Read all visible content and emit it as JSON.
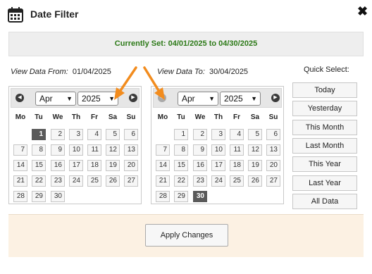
{
  "dialog": {
    "title": "Date Filter",
    "close_label": "✖"
  },
  "current_set": "Currently Set: 04/01/2025 to 04/30/2025",
  "range": {
    "from_label": "View Data From:",
    "from_value": "01/04/2025",
    "to_label": "View Data To:",
    "to_value": "30/04/2025"
  },
  "weekdays": [
    "Mo",
    "Tu",
    "We",
    "Th",
    "Fr",
    "Sa",
    "Su"
  ],
  "from_calendar": {
    "month": "Apr",
    "year": "2025",
    "prev_label": "◀",
    "next_label": "▶",
    "start_weekday_index": 1,
    "days_in_month": 30,
    "selected_day": 1
  },
  "to_calendar": {
    "month": "Apr",
    "year": "2025",
    "prev_label": "◀",
    "next_label": "▶",
    "prev_disabled": true,
    "start_weekday_index": 1,
    "days_in_month": 30,
    "selected_day": 30
  },
  "quick_select": {
    "label": "Quick Select:",
    "buttons": [
      "Today",
      "Yesterday",
      "This Month",
      "Last Month",
      "This Year",
      "Last Year",
      "All Data"
    ]
  },
  "apply_label": "Apply Changes",
  "colors": {
    "status_text": "#2d7a18",
    "footer_bg": "#fcf1e3",
    "annotation_arrow": "#f28c1e",
    "selected_day": "#5a5a5a"
  }
}
